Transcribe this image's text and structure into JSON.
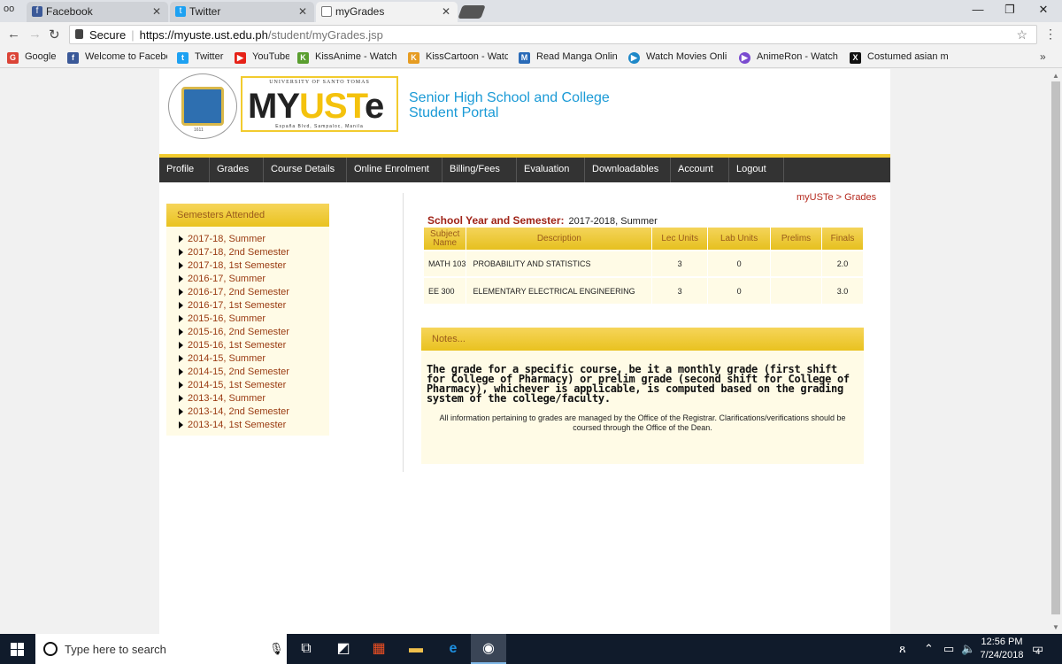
{
  "browser": {
    "tabs": [
      {
        "label": "Facebook",
        "icon": "facebook-icon",
        "color": "#3b5998"
      },
      {
        "label": "Twitter",
        "icon": "twitter-icon",
        "color": "#1da1f2"
      },
      {
        "label": "myGrades",
        "icon": "page-icon",
        "color": "#777777"
      }
    ],
    "security_label": "Secure",
    "url_host": "https://myuste.ust.edu.ph",
    "url_path": "/student/myGrades.jsp",
    "bookmarks": [
      {
        "label": "Google",
        "icon": "google-icon",
        "color": "#db4437",
        "glyph": "G"
      },
      {
        "label": "Welcome to Faceboo",
        "icon": "facebook-icon",
        "color": "#3b5998",
        "glyph": "f"
      },
      {
        "label": "Twitter",
        "icon": "twitter-icon",
        "color": "#1da1f2",
        "glyph": "t"
      },
      {
        "label": "YouTube",
        "icon": "youtube-icon",
        "color": "#e62117",
        "glyph": "▶"
      },
      {
        "label": "KissAnime - Watch a",
        "icon": "kissanime-icon",
        "color": "#5a9e2f",
        "glyph": "K"
      },
      {
        "label": "KissCartoon - Watch",
        "icon": "kisscartoon-icon",
        "color": "#e69c22",
        "glyph": "K"
      },
      {
        "label": "Read Manga Online",
        "icon": "manga-icon",
        "color": "#2a6bb8",
        "glyph": "M"
      },
      {
        "label": "Watch Movies Onlin",
        "icon": "movies-icon",
        "color": "#1e88c8",
        "glyph": "▶"
      },
      {
        "label": "AnimeRon - Watch A",
        "icon": "animeron-icon",
        "color": "#7a4bd0",
        "glyph": "▶"
      },
      {
        "label": "Costumed asian mo",
        "icon": "x-icon",
        "color": "#111111",
        "glyph": "X"
      }
    ]
  },
  "header": {
    "logo_university": "UNIVERSITY OF SANTO TOMAS",
    "logo_my": "MY",
    "logo_ust": "UST",
    "logo_e": "e",
    "logo_address": "España Blvd, Sampaloc, Manila",
    "seal_year": "1611",
    "portal_title_line1": "Senior High School and College",
    "portal_title_line2": "Student Portal"
  },
  "nav": [
    "Profile",
    "Grades",
    "Course Details",
    "Online Enrolment",
    "Billing/Fees",
    "Evaluation",
    "Downloadables",
    "Account",
    "Logout"
  ],
  "breadcrumb": "myUSTe > Grades",
  "sidebar": {
    "title": "Semesters Attended",
    "items": [
      "2017-18, Summer",
      "2017-18, 2nd Semester",
      "2017-18, 1st Semester",
      "2016-17, Summer",
      "2016-17, 2nd Semester",
      "2016-17, 1st Semester",
      "2015-16, Summer",
      "2015-16, 2nd Semester",
      "2015-16, 1st Semester",
      "2014-15, Summer",
      "2014-15, 2nd Semester",
      "2014-15, 1st Semester",
      "2013-14, Summer",
      "2013-14, 2nd Semester",
      "2013-14, 1st Semester"
    ]
  },
  "grades": {
    "sy_label": "School Year and Semester:",
    "sy_value": "2017-2018, Summer",
    "columns": [
      "Subject Name",
      "Description",
      "Lec Units",
      "Lab Units",
      "Prelims",
      "Finals"
    ],
    "rows": [
      {
        "subject": "MATH 103",
        "description": "PROBABILITY AND STATISTICS",
        "lec": "3",
        "lab": "0",
        "prelims": "",
        "finals": "2.0"
      },
      {
        "subject": "EE 300",
        "description": "ELEMENTARY ELECTRICAL ENGINEERING",
        "lec": "3",
        "lab": "0",
        "prelims": "",
        "finals": "3.0"
      }
    ]
  },
  "notes": {
    "title": "Notes...",
    "bold": "The grade for a specific course, be it a monthly grade (first shift for College of Pharmacy) or prelim grade (second shift for College of Pharmacy), whichever is applicable, is computed based on the grading system of the college/faculty.",
    "small": "All information pertaining to grades are managed by the Office of the Registrar. Clarifications/verifications should be coursed through the Office of the Dean."
  },
  "taskbar": {
    "search_placeholder": "Type here to search",
    "time": "12:56 PM",
    "date": "7/24/2018",
    "notification_count": "4"
  }
}
